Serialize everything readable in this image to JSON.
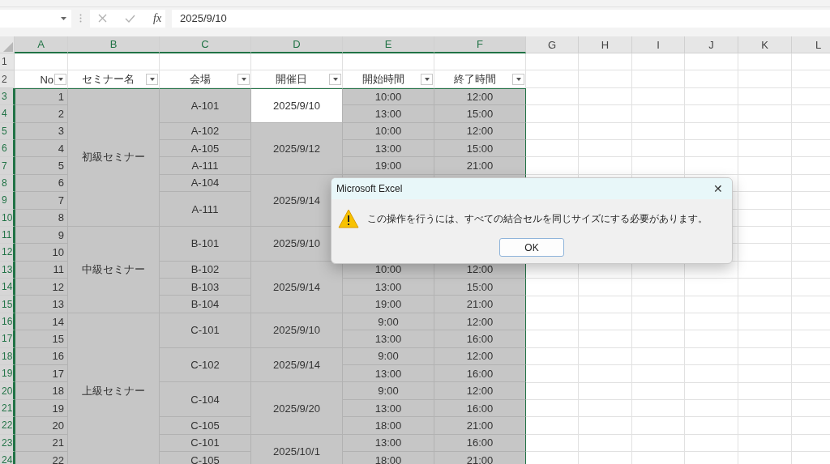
{
  "formula_bar": {
    "function_label": "fx",
    "value": "2025/9/10"
  },
  "column_headers": [
    {
      "label": "A",
      "selected": true
    },
    {
      "label": "B",
      "selected": true
    },
    {
      "label": "C",
      "selected": true
    },
    {
      "label": "D",
      "selected": true
    },
    {
      "label": "E",
      "selected": true
    },
    {
      "label": "F",
      "selected": true
    },
    {
      "label": "G",
      "selected": false
    },
    {
      "label": "H",
      "selected": false
    },
    {
      "label": "I",
      "selected": false
    },
    {
      "label": "J",
      "selected": false
    },
    {
      "label": "K",
      "selected": false
    },
    {
      "label": "L",
      "selected": false
    }
  ],
  "rows": [
    {
      "number": "1",
      "selected": false,
      "cells": []
    },
    {
      "number": "2",
      "selected": false,
      "cells": [
        {
          "text": "No",
          "filter": true
        },
        {
          "text": "セミナー名",
          "filter": true
        },
        {
          "text": "会場",
          "filter": true
        },
        {
          "text": "開催日",
          "filter": true
        },
        {
          "text": "開始時間",
          "filter": true
        },
        {
          "text": "終了時間",
          "filter": true
        }
      ]
    },
    {
      "number": "3",
      "selected": true,
      "cells": [
        {
          "text": "1"
        },
        {
          "text": "初級セミナー"
        },
        {
          "text": "A-101"
        },
        {
          "text": "2025/9/10",
          "active": true
        },
        {
          "text": "10:00"
        },
        {
          "text": "12:00"
        }
      ]
    },
    {
      "number": "4",
      "selected": true,
      "cells": [
        {
          "text": "2"
        },
        null,
        null,
        null,
        {
          "text": "13:00"
        },
        {
          "text": "15:00"
        }
      ]
    },
    {
      "number": "5",
      "selected": true,
      "cells": [
        {
          "text": "3"
        },
        null,
        {
          "text": "A-102"
        },
        {
          "text": "2025/9/12"
        },
        {
          "text": "10:00"
        },
        {
          "text": "12:00"
        }
      ]
    },
    {
      "number": "6",
      "selected": true,
      "cells": [
        {
          "text": "4"
        },
        null,
        {
          "text": "A-105"
        },
        null,
        {
          "text": "13:00"
        },
        {
          "text": "15:00"
        }
      ]
    },
    {
      "number": "7",
      "selected": true,
      "cells": [
        {
          "text": "5"
        },
        null,
        {
          "text": "A-111"
        },
        null,
        {
          "text": "19:00"
        },
        {
          "text": "21:00"
        }
      ]
    },
    {
      "number": "8",
      "selected": true,
      "cells": [
        {
          "text": "6"
        },
        null,
        {
          "text": "A-104"
        },
        {
          "text": "2025/9/14"
        },
        {},
        {}
      ]
    },
    {
      "number": "9",
      "selected": true,
      "cells": [
        {
          "text": "7"
        },
        null,
        {
          "text": "A-111"
        },
        null
      ]
    },
    {
      "number": "10",
      "selected": true,
      "cells": [
        {
          "text": "8"
        },
        null,
        null,
        null
      ]
    },
    {
      "number": "11",
      "selected": true,
      "cells": [
        {
          "text": "9"
        },
        {
          "text": "中級セミナー"
        },
        {
          "text": "B-101"
        },
        {
          "text": "2025/9/10"
        },
        {},
        {}
      ]
    },
    {
      "number": "12",
      "selected": true,
      "cells": [
        {
          "text": "10"
        },
        null,
        null,
        null,
        {},
        {}
      ]
    },
    {
      "number": "13",
      "selected": true,
      "cells": [
        {
          "text": "11"
        },
        null,
        {
          "text": "B-102"
        },
        {
          "text": "2025/9/14"
        },
        {
          "text": "10:00"
        },
        {
          "text": "12:00"
        }
      ]
    },
    {
      "number": "14",
      "selected": true,
      "cells": [
        {
          "text": "12"
        },
        null,
        {
          "text": "B-103"
        },
        null,
        {
          "text": "13:00"
        },
        {
          "text": "15:00"
        }
      ]
    },
    {
      "number": "15",
      "selected": true,
      "cells": [
        {
          "text": "13"
        },
        null,
        {
          "text": "B-104"
        },
        null,
        {
          "text": "19:00"
        },
        {
          "text": "21:00"
        }
      ]
    },
    {
      "number": "16",
      "selected": true,
      "cells": [
        {
          "text": "14"
        },
        {
          "text": "上級セミナー"
        },
        {
          "text": "C-101"
        },
        {
          "text": "2025/9/10"
        },
        {
          "text": "9:00"
        },
        {
          "text": "12:00"
        }
      ]
    },
    {
      "number": "17",
      "selected": true,
      "cells": [
        {
          "text": "15"
        },
        null,
        null,
        null,
        {
          "text": "13:00"
        },
        {
          "text": "16:00"
        }
      ]
    },
    {
      "number": "18",
      "selected": true,
      "cells": [
        {
          "text": "16"
        },
        null,
        {
          "text": "C-102"
        },
        {
          "text": "2025/9/14"
        },
        {
          "text": "9:00"
        },
        {
          "text": "12:00"
        }
      ]
    },
    {
      "number": "19",
      "selected": true,
      "cells": [
        {
          "text": "17"
        },
        null,
        null,
        null,
        {
          "text": "13:00"
        },
        {
          "text": "16:00"
        }
      ]
    },
    {
      "number": "20",
      "selected": true,
      "cells": [
        {
          "text": "18"
        },
        null,
        {
          "text": "C-104"
        },
        {
          "text": "2025/9/20"
        },
        {
          "text": "9:00"
        },
        {
          "text": "12:00"
        }
      ]
    },
    {
      "number": "21",
      "selected": true,
      "cells": [
        {
          "text": "19"
        },
        null,
        null,
        null,
        {
          "text": "13:00"
        },
        {
          "text": "16:00"
        }
      ]
    },
    {
      "number": "22",
      "selected": true,
      "cells": [
        {
          "text": "20"
        },
        null,
        {
          "text": "C-105"
        },
        null,
        {
          "text": "18:00"
        },
        {
          "text": "21:00"
        }
      ]
    },
    {
      "number": "23",
      "selected": true,
      "cells": [
        {
          "text": "21"
        },
        null,
        {
          "text": "C-101"
        },
        {
          "text": "2025/10/1"
        },
        {
          "text": "13:00"
        },
        {
          "text": "16:00"
        }
      ]
    },
    {
      "number": "24",
      "selected": true,
      "cells": [
        {
          "text": "22"
        },
        null,
        {
          "text": "C-105"
        },
        null,
        {
          "text": "18:00"
        },
        {
          "text": "21:00"
        }
      ]
    }
  ],
  "dialog": {
    "title": "Microsoft Excel",
    "close": "✕",
    "message": "この操作を行うには、すべての結合セルを同じサイズにする必要があります。",
    "button": "OK"
  }
}
